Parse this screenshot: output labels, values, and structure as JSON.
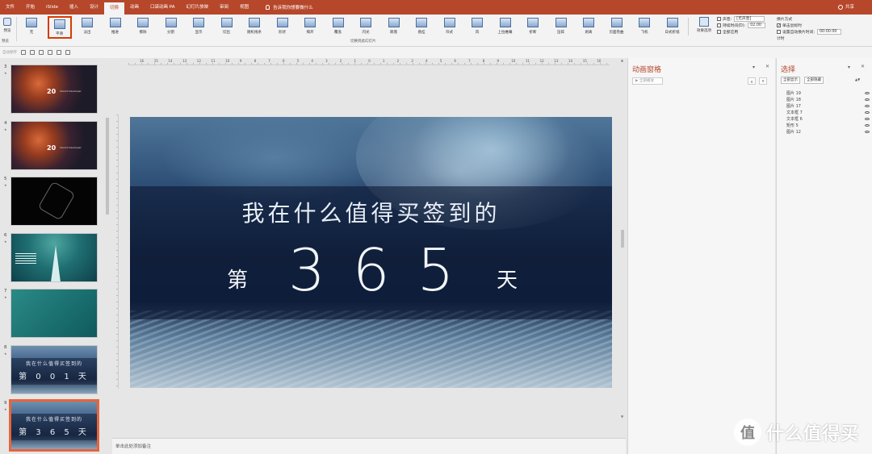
{
  "tabs": [
    "文件",
    "开始",
    "iSlide",
    "插入",
    "设计",
    "切换",
    "动画",
    "口袋动画 PA",
    "幻灯片放映",
    "审阅",
    "视图"
  ],
  "active_tab": "切换",
  "tell_me": "告诉我你想要做什么",
  "share": "共享",
  "ribbon": {
    "preview_label": "预览",
    "preview_group": "预览",
    "transitions": [
      "无",
      "平滑",
      "淡出",
      "推进",
      "擦除",
      "分割",
      "显示",
      "切出",
      "随机线条",
      "形状",
      "揭开",
      "覆盖",
      "闪光",
      "跌落",
      "悬挂",
      "帘式",
      "风",
      "上拉帷幕",
      "折断",
      "压碎",
      "剥离",
      "页面卷曲",
      "飞机",
      "日式折纸"
    ],
    "selected_transition": "平滑",
    "group_label": "切换到此幻灯片",
    "effect_options": "效果选项",
    "sound_label": "声音:",
    "sound_value": "[无声音]",
    "duration_label": "持续时间(D):",
    "duration_value": "02.00",
    "apply_all": "全部应用",
    "advance_title": "换片方式",
    "on_click": "单击鼠标时",
    "after_time": "设置自动换片时间:",
    "after_value": "00:00.00",
    "timing_group": "计时"
  },
  "qab_label": "自动保存",
  "slides": [
    {
      "num": "3",
      "style": "orange",
      "year": "20",
      "sub": "Xiaomi Developer"
    },
    {
      "num": "4",
      "style": "orange",
      "year": "20",
      "sub": "Xiaomi Developer"
    },
    {
      "num": "5",
      "style": "dark"
    },
    {
      "num": "6",
      "style": "teal1"
    },
    {
      "num": "7",
      "style": "teal2"
    },
    {
      "num": "8",
      "style": "wave",
      "line1": "我在什么值得买签到的",
      "line2": "第 0 0 1 天"
    },
    {
      "num": "9",
      "style": "wave",
      "line1": "我在什么值得买签到的",
      "line2": "第 3 6 5 天"
    }
  ],
  "main_slide": {
    "line1": "我在什么值得买签到的",
    "di": "第",
    "number": "365",
    "tian": "天"
  },
  "notes_placeholder": "单击此处添加备注",
  "animation_pane": {
    "title": "动画窗格",
    "play_all": "全部播放"
  },
  "selection_pane": {
    "title": "选择",
    "show_all": "全部显示",
    "hide_all": "全部隐藏",
    "items": [
      "图片 19",
      "图片 18",
      "图片 17",
      "文本框 7",
      "文本框 6",
      "矩形 5",
      "图片 12"
    ]
  },
  "ruler_numbers": [
    "16",
    "15",
    "14",
    "13",
    "12",
    "11",
    "10",
    "9",
    "8",
    "7",
    "6",
    "5",
    "4",
    "3",
    "2",
    "1",
    "0",
    "1",
    "2",
    "3",
    "4",
    "5",
    "6",
    "7",
    "8",
    "9",
    "10",
    "11",
    "12",
    "13",
    "14",
    "15",
    "16"
  ],
  "watermark": {
    "logo": "值",
    "text": "什么值得买"
  },
  "colors": {
    "accent": "#b7472a",
    "selection_red": "#d83b01"
  }
}
